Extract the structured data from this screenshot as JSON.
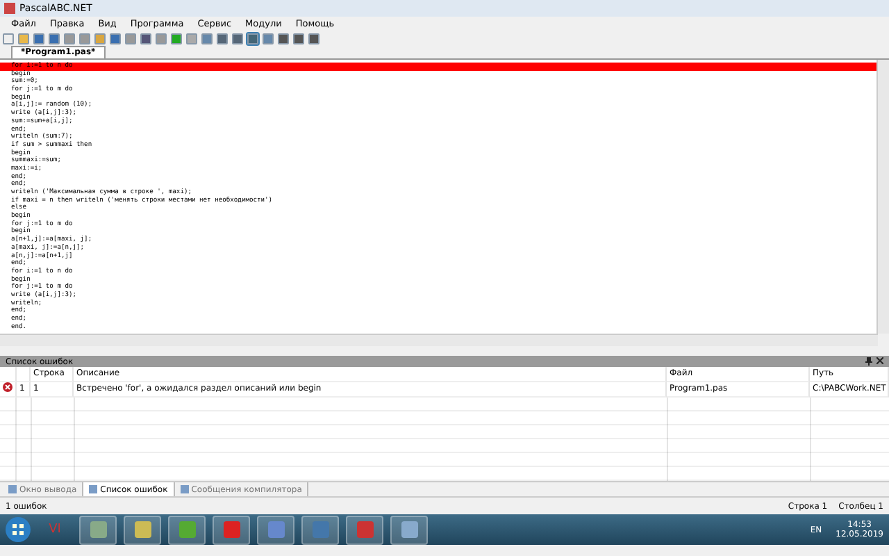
{
  "window": {
    "title": "PascalABC.NET"
  },
  "menu": [
    "Файл",
    "Правка",
    "Вид",
    "Программа",
    "Сервис",
    "Модули",
    "Помощь"
  ],
  "tabs": [
    {
      "label": "*Program1.pas*",
      "selected": true
    }
  ],
  "editor": {
    "error_line_text": "for i:=1 to n do",
    "lines": [
      "begin",
      "sum:=0;",
      "for j:=1 to m do",
      "begin",
      "a[i,j]:= random (10);",
      "write (a[i,j]:3);",
      "sum:=sum+a[i,j];",
      "end;",
      "writeln (sum:7);",
      "if sum > summaxi then",
      "begin",
      "summaxi:=sum;",
      "maxi:=i;",
      "end;",
      "end;",
      "writeln ('Максимальная сумма в строке ', maxi);",
      "if maxi = n then writeln ('менять строки местами нет необходимости')",
      "else",
      "begin",
      "for j:=1 to m do",
      "begin",
      "a[n+1,j]:=a[maxi, j];",
      "a[maxi, j]:=a[n,j];",
      "a[n,j]:=a[n+1,j]",
      "end;",
      "for i:=1 to n do",
      "begin",
      "for j:=1 to m do",
      "write (a[i,j]:3);",
      "writeln;",
      "end;",
      "end;",
      "end."
    ]
  },
  "error_panel": {
    "title": "Список ошибок",
    "columns": [
      "",
      "Строка",
      "Описание",
      "Файл",
      "Путь"
    ],
    "rows": [
      {
        "number": "1",
        "line": "1",
        "description": "Встречено 'for', а ожидался раздел описаний или begin",
        "file": "Program1.pas",
        "path": "C:\\PABCWork.NET"
      }
    ]
  },
  "bottom_tabs": [
    {
      "label": "Окно вывода",
      "selected": false
    },
    {
      "label": "Список ошибок",
      "selected": true
    },
    {
      "label": "Сообщения компилятора",
      "selected": false
    }
  ],
  "status_bar": {
    "left": "1 ошибок",
    "row": "Строка  1",
    "col": "Столбец  1"
  },
  "taskbar": {
    "app_labels": [
      "VI"
    ],
    "language": "EN",
    "time": "14:53",
    "date": "12.05.2019"
  }
}
